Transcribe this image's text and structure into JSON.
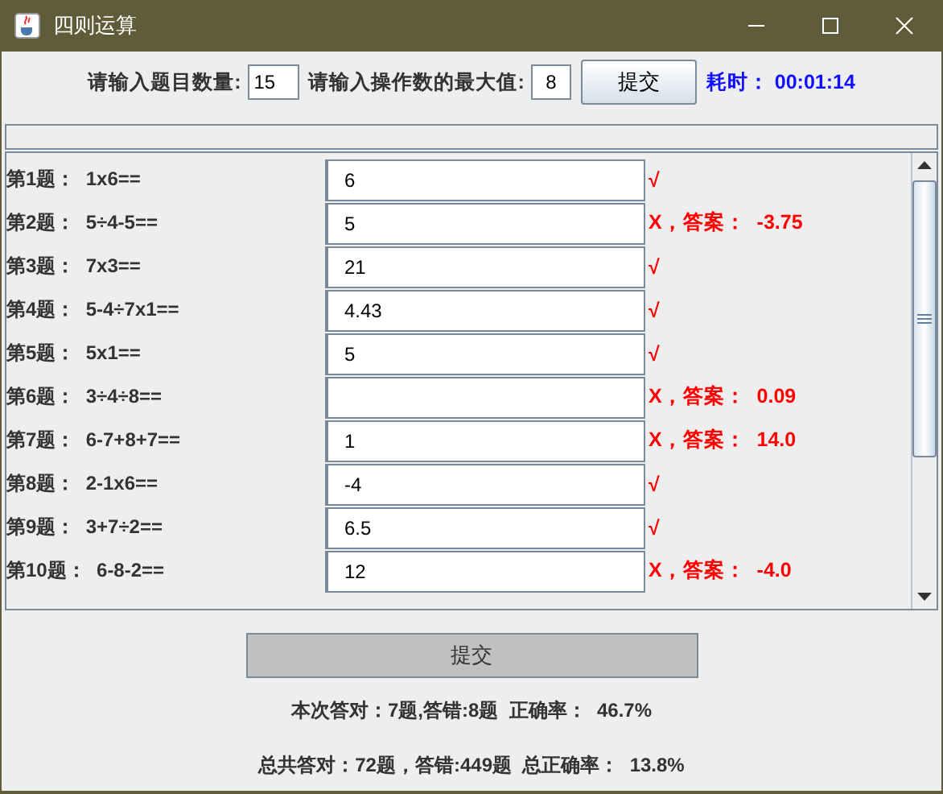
{
  "window": {
    "title": "四则运算"
  },
  "settings": {
    "count_label": "请输入题目数量:",
    "count_value": "15",
    "max_label": "请输入操作数的最大值:",
    "max_value": "8",
    "submit": "提交",
    "timer": "耗时：  00:01:14"
  },
  "questions": [
    {
      "label": "第1题：  1x6==",
      "answer": "6",
      "result": "√"
    },
    {
      "label": "第2题：  5÷4-5==",
      "answer": "5",
      "result": "X，答案：  -3.75"
    },
    {
      "label": "第3题：  7x3==",
      "answer": "21",
      "result": "√"
    },
    {
      "label": "第4题：  5-4÷7x1==",
      "answer": "4.43",
      "result": "√"
    },
    {
      "label": "第5题：  5x1==",
      "answer": "5",
      "result": "√"
    },
    {
      "label": "第6题：  3÷4÷8==",
      "result": "X，答案：  0.09"
    },
    {
      "label": "第7题：  6-7+8+7==",
      "answer": "1",
      "result": "X，答案：  14.0"
    },
    {
      "label": "第8题：  2-1x6==",
      "answer": "-4",
      "result": "√"
    },
    {
      "label": "第9题：  3+7÷2==",
      "answer": "6.5",
      "result": "√"
    },
    {
      "label": "第10题：  6-8-2==",
      "answer": "12",
      "result": "X，答案：  -4.0"
    }
  ],
  "progress": {
    "level": 0
  },
  "submit_button": "提交",
  "summary": [
    "本次答对：7题,答错:8题  正确率：  46.7%",
    "总共答对：72题，答错:449题  总正确率：  13.8%"
  ]
}
